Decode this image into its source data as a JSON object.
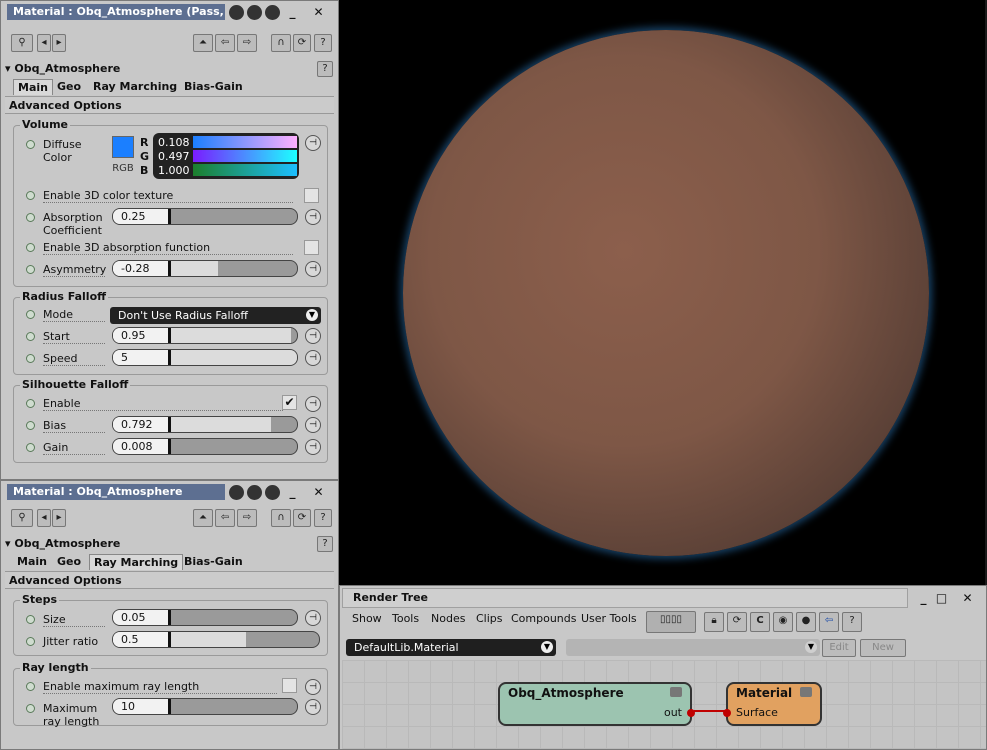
{
  "colors": {
    "panel_bg": "#c8c8c8",
    "title_active": "#5d6f91",
    "node_material": "#e1a160",
    "node_atmo": "#9cc4b0",
    "wire": "#c00000"
  },
  "panel1": {
    "title": "Material : Obq_Atmosphere (Pass,...",
    "section": "Obq_Atmosphere",
    "tabs": [
      "Main",
      "Geo",
      "Ray Marching",
      "Bias-Gain"
    ],
    "active_tab": "Main",
    "advanced": "Advanced Options",
    "volume": {
      "label": "Volume",
      "diffuse_label1": "Diffuse",
      "diffuse_label2": "Color",
      "rgb_button": "RGB",
      "r_label": "R",
      "g_label": "G",
      "b_label": "B",
      "r": "0.108",
      "g": "0.497",
      "b": "1.000",
      "enable_3d_color": "Enable 3D color texture",
      "absorption_label1": "Absorption",
      "absorption_label2": "Coefficient",
      "absorption": "0.25",
      "enable_3d_absorption": "Enable 3D absorption function",
      "asymmetry_label": "Asymmetry",
      "asymmetry": "-0.28"
    },
    "radius": {
      "label": "Radius Falloff",
      "mode_label": "Mode",
      "mode_value": "Don't Use Radius Falloff",
      "start_label": "Start",
      "start": "0.95",
      "speed_label": "Speed",
      "speed": "5"
    },
    "silhouette": {
      "label": "Silhouette Falloff",
      "enable_label": "Enable",
      "enable_checked": "✔",
      "bias_label": "Bias",
      "bias": "0.792",
      "gain_label": "Gain",
      "gain": "0.008"
    }
  },
  "panel2": {
    "title": "Material : Obq_Atmosphere",
    "section": "Obq_Atmosphere",
    "tabs": [
      "Main",
      "Geo",
      "Ray Marching",
      "Bias-Gain"
    ],
    "active_tab": "Ray Marching",
    "advanced": "Advanced Options",
    "steps": {
      "label": "Steps",
      "size_label": "Size",
      "size": "0.05",
      "jitter_label": "Jitter ratio",
      "jitter": "0.5"
    },
    "raylength": {
      "label": "Ray length",
      "enable_label": "Enable maximum ray length",
      "max_label1": "Maximum",
      "max_label2": "ray length",
      "max": "10"
    }
  },
  "render_tree": {
    "title": "Render Tree",
    "menu": [
      "Show",
      "Tools",
      "Nodes",
      "Clips",
      "Compounds",
      "User Tools"
    ],
    "library": "DefaultLib.Material",
    "edit_button": "Edit",
    "new_button": "New",
    "node_atmo": {
      "title": "Obq_Atmosphere",
      "port": "out"
    },
    "node_material": {
      "title": "Material",
      "port": "Surface"
    }
  }
}
